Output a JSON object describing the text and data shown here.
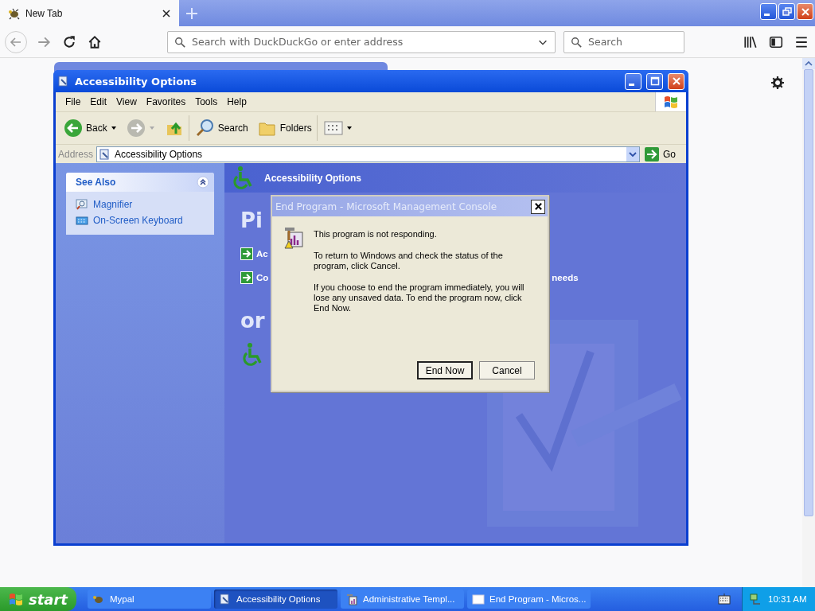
{
  "browser": {
    "tab": {
      "title": "New Tab"
    },
    "address": {
      "placeholder": "Search with DuckDuckGo or enter address"
    },
    "search": {
      "placeholder": "Search"
    }
  },
  "explorer": {
    "title": "Accessibility Options",
    "menu": [
      "File",
      "Edit",
      "View",
      "Favorites",
      "Tools",
      "Help"
    ],
    "toolbar": [
      {
        "kind": "back",
        "label": "Back"
      },
      {
        "kind": "forward"
      },
      {
        "kind": "up"
      },
      {
        "kind": "search",
        "label": "Search"
      },
      {
        "kind": "folders",
        "label": "Folders"
      },
      {
        "kind": "views"
      }
    ],
    "address": {
      "label": "Address",
      "value": "Accessibility Options",
      "go": "Go"
    },
    "see_also": {
      "title": "See Also",
      "items": [
        {
          "kind": "magnifier",
          "label": "Magnifier"
        },
        {
          "kind": "keyboard",
          "label": "On-Screen Keyboard"
        }
      ]
    },
    "header": "Accessibility Options",
    "heading_1": "Pi",
    "tasks": [
      {
        "text": "Ac"
      },
      {
        "text": "Co",
        "tail": "needs"
      }
    ],
    "heading_2": "or"
  },
  "dialog": {
    "title": "End Program - Microsoft Management Console",
    "paragraphs": [
      "This program is not responding.",
      "To return to Windows and check the status of the program, click Cancel.",
      "If you choose to end the program immediately, you will lose any unsaved data. To end the program now, click End Now."
    ],
    "buttons": [
      {
        "label": "End Now",
        "default": true
      },
      {
        "label": "Cancel",
        "default": false
      }
    ]
  },
  "taskbar": {
    "start": "start",
    "items": [
      {
        "kind": "mypal",
        "label": "Mypal",
        "selected": false
      },
      {
        "kind": "explorer",
        "label": "Accessibility Options",
        "selected": true
      },
      {
        "kind": "admin",
        "label": "Administrative Templ...",
        "selected": false
      },
      {
        "kind": "window",
        "label": "End Program - Micros...",
        "selected": false
      }
    ],
    "clock": "10:31 AM"
  }
}
